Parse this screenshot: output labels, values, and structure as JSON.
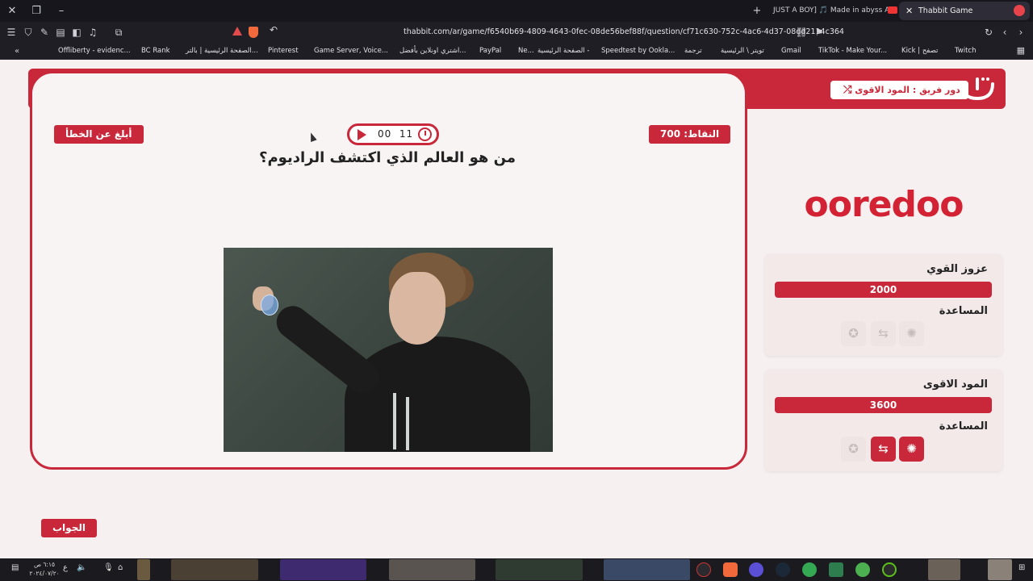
{
  "browser": {
    "tabs": [
      {
        "label": "JUST A BOY] 🎵 Made in abyss AMV",
        "active": false
      },
      {
        "label": "Thabbit Game",
        "active": true
      }
    ],
    "url": "thabbit.com/ar/game/f6540b69-4809-4643-0fec-08de56bef88f/question/cf71c630-752c-4ac6-4d37-08dd2114c364",
    "bookmarks": [
      "Offliberty - evidenc...",
      "BC Rank",
      "الصفحة الرئيسية | بالتر...",
      "Pinterest",
      "Game Server, Voice...",
      "اشتري اونلاين بأفضل...",
      "PayPal",
      "Ne...",
      "الصفحة الرئيسية -",
      "Speedtest by Ookla...",
      "ترجمة",
      "تويتر \\ الرئيسية",
      "Gmail",
      "TikTok - Make Your...",
      "Kick | تصفح",
      "Twitch"
    ]
  },
  "header": {
    "turn_label": "دور فريق : المود الاقوى"
  },
  "question_card": {
    "report_label": "أبلغ عن الخطأ",
    "points_label": "النقاط: 700",
    "timer_minutes": "00",
    "timer_seconds": "11",
    "question": "من هو العالم الذي اكتشف الراديوم؟",
    "answer_label": "الجواب"
  },
  "sponsor": {
    "name": "ooredoo"
  },
  "teams": [
    {
      "name": "عزوز القوي",
      "score": "2000",
      "help_label": "المساعدة",
      "helps": [
        {
          "icon": "hint-bulb-icon",
          "used": true
        },
        {
          "icon": "swap-icon",
          "used": true
        },
        {
          "icon": "star-icon",
          "used": true
        }
      ]
    },
    {
      "name": "المود الاقوى",
      "score": "3600",
      "help_label": "المساعدة",
      "helps": [
        {
          "icon": "hint-bulb-icon",
          "used": false
        },
        {
          "icon": "swap-icon",
          "used": false
        },
        {
          "icon": "star-icon",
          "used": true
        }
      ]
    }
  ],
  "taskbar": {
    "time": "٦:١٥ ص",
    "date": "٢٠٢٤/٠٧/٢٠",
    "lang": "ع"
  },
  "colors": {
    "brand_red": "#c8283a",
    "page_bg": "#f6f0f0"
  }
}
